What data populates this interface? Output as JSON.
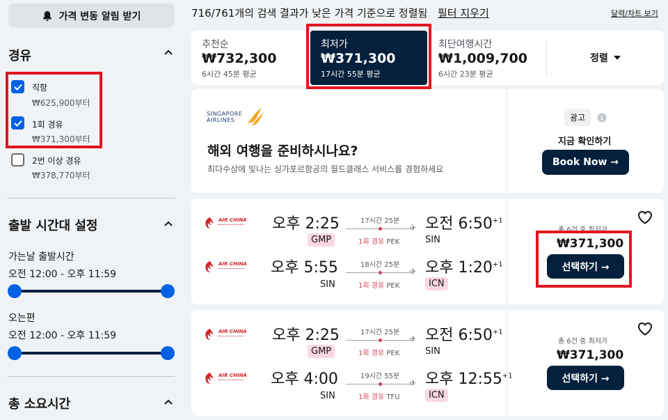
{
  "sidebar": {
    "alert_button": "가격 변동 알림 받기",
    "stops": {
      "title": "경유",
      "options": [
        {
          "label": "직항",
          "price": "₩625,900부터",
          "checked": true
        },
        {
          "label": "1회 경유",
          "price": "₩371,300부터",
          "checked": true
        },
        {
          "label": "2번 이상 경유",
          "price": "₩378,770부터",
          "checked": false
        }
      ]
    },
    "departure_time": {
      "title": "출발 시간대 설정",
      "outbound_label": "가는날 출발시간",
      "outbound_range": "오전 12:00 - 오후 11:59",
      "return_label": "오는편",
      "return_range": "오전 12:00 - 오후 11:59"
    },
    "duration": {
      "title": "총 소요시간"
    }
  },
  "header": {
    "results_text": "716/761개의 검색 결과가 낮은 가격 기준으로 정렬됨",
    "clear_filters": "필터 지우기",
    "calendar_link": "달력/차트 보기"
  },
  "sort_tabs": [
    {
      "label": "추천순",
      "price": "₩732,300",
      "sub": "6시간 45분 평균",
      "active": false
    },
    {
      "label": "최저가",
      "price": "₩371,300",
      "sub": "17시간 55분 평균",
      "active": true
    },
    {
      "label": "최단여행시간",
      "price": "₩1,009,700",
      "sub": "6시간 23분 평균",
      "active": false
    }
  ],
  "sort_dropdown": "정렬",
  "ad": {
    "brand_line1": "SINGAPORE",
    "brand_line2": "AIRLINES",
    "title": "해외 여행을 준비하시나요?",
    "description": "최다수상에 빛나는 싱가포르항공의 월드클래스 서비스를 경험하세요",
    "tag": "광고",
    "cta_heading": "지금 확인하기",
    "cta_button": "Book Now →"
  },
  "results": [
    {
      "airline_logo_text": "AIR CHINA",
      "legs": [
        {
          "dep_time": "오후 2:25",
          "dep_code": "GMP",
          "dep_hl": true,
          "duration": "17시간 25분",
          "stops_count": "1회 경유",
          "stop_code": "PEK",
          "arr_time": "오전 6:50",
          "arr_plus": "+1",
          "arr_code": "SIN",
          "arr_hl": false
        },
        {
          "dep_time": "오후 5:55",
          "dep_code": "SIN",
          "dep_hl": false,
          "duration": "18시간 25분",
          "stops_count": "1회 경유",
          "stop_code": "PEK",
          "arr_time": "오후 1:20",
          "arr_plus": "+1",
          "arr_code": "ICN",
          "arr_hl": true
        }
      ],
      "cheapest_label": "총 6건 중 최저가",
      "price": "₩371,300",
      "select_button": "선택하기 →"
    },
    {
      "airline_logo_text": "AIR CHINA",
      "legs": [
        {
          "dep_time": "오후 2:25",
          "dep_code": "GMP",
          "dep_hl": true,
          "duration": "17시간 25분",
          "stops_count": "1회 경유",
          "stop_code": "PEK",
          "arr_time": "오전 6:50",
          "arr_plus": "+1",
          "arr_code": "SIN",
          "arr_hl": false
        },
        {
          "dep_time": "오후 4:00",
          "dep_code": "SIN",
          "dep_hl": false,
          "duration": "19시간 55분",
          "stops_count": "1회 경유",
          "stop_code": "TFU",
          "arr_time": "오후 12:55",
          "arr_plus": "+1",
          "arr_code": "ICN",
          "arr_hl": true
        }
      ],
      "cheapest_label": "총 6건 중 최저가",
      "price": "₩371,300",
      "select_button": "선택하기 →"
    }
  ],
  "colors": {
    "accent": "#0062e3",
    "dark": "#05203c",
    "highlight_box": "#e0161f",
    "stop_red": "#d1435b",
    "code_pink": "#fbd7e3"
  }
}
